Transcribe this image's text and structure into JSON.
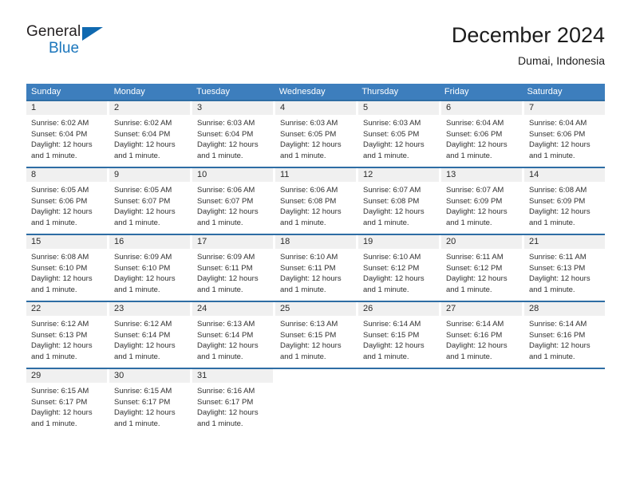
{
  "brand": {
    "name_part1": "General",
    "name_part2": "Blue",
    "logo_icon": "triangle-flag-icon"
  },
  "header": {
    "title": "December 2024",
    "location": "Dumai, Indonesia"
  },
  "colors": {
    "header_band": "#3d7ebd",
    "week_divider": "#2e6da4",
    "daynum_band": "#f0f0f0",
    "brand_blue": "#1b76bc",
    "text": "#303030"
  },
  "weekdays": [
    "Sunday",
    "Monday",
    "Tuesday",
    "Wednesday",
    "Thursday",
    "Friday",
    "Saturday"
  ],
  "weeks": [
    [
      {
        "day": "1",
        "sunrise": "Sunrise: 6:02 AM",
        "sunset": "Sunset: 6:04 PM",
        "daylight": "Daylight: 12 hours and 1 minute."
      },
      {
        "day": "2",
        "sunrise": "Sunrise: 6:02 AM",
        "sunset": "Sunset: 6:04 PM",
        "daylight": "Daylight: 12 hours and 1 minute."
      },
      {
        "day": "3",
        "sunrise": "Sunrise: 6:03 AM",
        "sunset": "Sunset: 6:04 PM",
        "daylight": "Daylight: 12 hours and 1 minute."
      },
      {
        "day": "4",
        "sunrise": "Sunrise: 6:03 AM",
        "sunset": "Sunset: 6:05 PM",
        "daylight": "Daylight: 12 hours and 1 minute."
      },
      {
        "day": "5",
        "sunrise": "Sunrise: 6:03 AM",
        "sunset": "Sunset: 6:05 PM",
        "daylight": "Daylight: 12 hours and 1 minute."
      },
      {
        "day": "6",
        "sunrise": "Sunrise: 6:04 AM",
        "sunset": "Sunset: 6:06 PM",
        "daylight": "Daylight: 12 hours and 1 minute."
      },
      {
        "day": "7",
        "sunrise": "Sunrise: 6:04 AM",
        "sunset": "Sunset: 6:06 PM",
        "daylight": "Daylight: 12 hours and 1 minute."
      }
    ],
    [
      {
        "day": "8",
        "sunrise": "Sunrise: 6:05 AM",
        "sunset": "Sunset: 6:06 PM",
        "daylight": "Daylight: 12 hours and 1 minute."
      },
      {
        "day": "9",
        "sunrise": "Sunrise: 6:05 AM",
        "sunset": "Sunset: 6:07 PM",
        "daylight": "Daylight: 12 hours and 1 minute."
      },
      {
        "day": "10",
        "sunrise": "Sunrise: 6:06 AM",
        "sunset": "Sunset: 6:07 PM",
        "daylight": "Daylight: 12 hours and 1 minute."
      },
      {
        "day": "11",
        "sunrise": "Sunrise: 6:06 AM",
        "sunset": "Sunset: 6:08 PM",
        "daylight": "Daylight: 12 hours and 1 minute."
      },
      {
        "day": "12",
        "sunrise": "Sunrise: 6:07 AM",
        "sunset": "Sunset: 6:08 PM",
        "daylight": "Daylight: 12 hours and 1 minute."
      },
      {
        "day": "13",
        "sunrise": "Sunrise: 6:07 AM",
        "sunset": "Sunset: 6:09 PM",
        "daylight": "Daylight: 12 hours and 1 minute."
      },
      {
        "day": "14",
        "sunrise": "Sunrise: 6:08 AM",
        "sunset": "Sunset: 6:09 PM",
        "daylight": "Daylight: 12 hours and 1 minute."
      }
    ],
    [
      {
        "day": "15",
        "sunrise": "Sunrise: 6:08 AM",
        "sunset": "Sunset: 6:10 PM",
        "daylight": "Daylight: 12 hours and 1 minute."
      },
      {
        "day": "16",
        "sunrise": "Sunrise: 6:09 AM",
        "sunset": "Sunset: 6:10 PM",
        "daylight": "Daylight: 12 hours and 1 minute."
      },
      {
        "day": "17",
        "sunrise": "Sunrise: 6:09 AM",
        "sunset": "Sunset: 6:11 PM",
        "daylight": "Daylight: 12 hours and 1 minute."
      },
      {
        "day": "18",
        "sunrise": "Sunrise: 6:10 AM",
        "sunset": "Sunset: 6:11 PM",
        "daylight": "Daylight: 12 hours and 1 minute."
      },
      {
        "day": "19",
        "sunrise": "Sunrise: 6:10 AM",
        "sunset": "Sunset: 6:12 PM",
        "daylight": "Daylight: 12 hours and 1 minute."
      },
      {
        "day": "20",
        "sunrise": "Sunrise: 6:11 AM",
        "sunset": "Sunset: 6:12 PM",
        "daylight": "Daylight: 12 hours and 1 minute."
      },
      {
        "day": "21",
        "sunrise": "Sunrise: 6:11 AM",
        "sunset": "Sunset: 6:13 PM",
        "daylight": "Daylight: 12 hours and 1 minute."
      }
    ],
    [
      {
        "day": "22",
        "sunrise": "Sunrise: 6:12 AM",
        "sunset": "Sunset: 6:13 PM",
        "daylight": "Daylight: 12 hours and 1 minute."
      },
      {
        "day": "23",
        "sunrise": "Sunrise: 6:12 AM",
        "sunset": "Sunset: 6:14 PM",
        "daylight": "Daylight: 12 hours and 1 minute."
      },
      {
        "day": "24",
        "sunrise": "Sunrise: 6:13 AM",
        "sunset": "Sunset: 6:14 PM",
        "daylight": "Daylight: 12 hours and 1 minute."
      },
      {
        "day": "25",
        "sunrise": "Sunrise: 6:13 AM",
        "sunset": "Sunset: 6:15 PM",
        "daylight": "Daylight: 12 hours and 1 minute."
      },
      {
        "day": "26",
        "sunrise": "Sunrise: 6:14 AM",
        "sunset": "Sunset: 6:15 PM",
        "daylight": "Daylight: 12 hours and 1 minute."
      },
      {
        "day": "27",
        "sunrise": "Sunrise: 6:14 AM",
        "sunset": "Sunset: 6:16 PM",
        "daylight": "Daylight: 12 hours and 1 minute."
      },
      {
        "day": "28",
        "sunrise": "Sunrise: 6:14 AM",
        "sunset": "Sunset: 6:16 PM",
        "daylight": "Daylight: 12 hours and 1 minute."
      }
    ],
    [
      {
        "day": "29",
        "sunrise": "Sunrise: 6:15 AM",
        "sunset": "Sunset: 6:17 PM",
        "daylight": "Daylight: 12 hours and 1 minute."
      },
      {
        "day": "30",
        "sunrise": "Sunrise: 6:15 AM",
        "sunset": "Sunset: 6:17 PM",
        "daylight": "Daylight: 12 hours and 1 minute."
      },
      {
        "day": "31",
        "sunrise": "Sunrise: 6:16 AM",
        "sunset": "Sunset: 6:17 PM",
        "daylight": "Daylight: 12 hours and 1 minute."
      },
      {
        "day": "",
        "sunrise": "",
        "sunset": "",
        "daylight": ""
      },
      {
        "day": "",
        "sunrise": "",
        "sunset": "",
        "daylight": ""
      },
      {
        "day": "",
        "sunrise": "",
        "sunset": "",
        "daylight": ""
      },
      {
        "day": "",
        "sunrise": "",
        "sunset": "",
        "daylight": ""
      }
    ]
  ]
}
